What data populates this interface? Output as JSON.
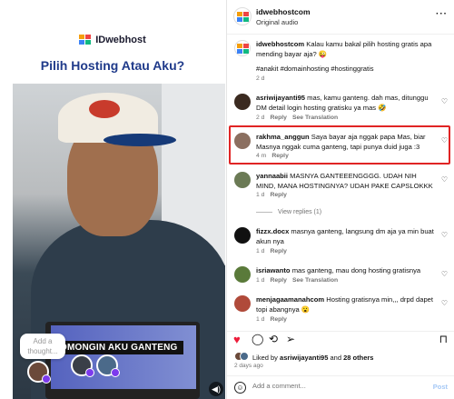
{
  "left": {
    "brand": "IDwebhost",
    "headline": "Pilih Hosting Atau Aku?",
    "caption": "GOMONGIN AKU GANTENG",
    "thought_placeholder": "Add a thought..."
  },
  "header": {
    "username": "idwebhostcom",
    "subtitle": "Original audio",
    "more": "···"
  },
  "caption_post": {
    "username": "idwebhostcom",
    "text": "Kalau kamu bakal pilih hosting gratis apa mending bayar aja? 😜",
    "tags": "#anakit #domainhosting #hostinggratis",
    "time": "2 d"
  },
  "comments": [
    {
      "user": "asriwijayanti95",
      "text": "mas, kamu ganteng. dah mas, ditunggu DM detail login hosting gratisku ya mas 🤣",
      "time": "2 d",
      "reply": "Reply",
      "translate": "See Translation",
      "color": "#3b2a20"
    },
    {
      "user": "rakhma_anggun",
      "text": "Saya bayar aja nggak papa Mas, biar Masnya nggak cuma ganteng, tapi punya duid juga :3",
      "time": "4 m",
      "reply": "Reply",
      "translate": "",
      "color": "#8b6f60"
    },
    {
      "user": "yannaabii",
      "text": "MASNYA GANTEEENGGGG. UDAH NIH MIND, MANA HOSTINGNYA? UDAH PAKE CAPSLOKKK",
      "time": "1 d",
      "reply": "Reply",
      "translate": "",
      "color": "#6b7a55"
    },
    {
      "user": "fizzx.docx",
      "text": "masnya ganteng, langsung dm aja ya min buat akun nya",
      "time": "1 d",
      "reply": "Reply",
      "translate": "",
      "color": "#111111"
    },
    {
      "user": "isriawanto",
      "text": "mas ganteng, mau dong hosting gratisnya",
      "time": "1 d",
      "reply": "Reply",
      "translate": "See Translation",
      "color": "#5a7a3a"
    },
    {
      "user": "menjagaamanahcom",
      "text": "Hosting gratisnya min,,, drpd dapet topi abangnya 😮",
      "time": "1 d",
      "reply": "Reply",
      "translate": "",
      "color": "#b04a3a"
    }
  ],
  "view_replies": "View replies (1)",
  "likes": {
    "prefix": "Liked by",
    "user": "asriwijayanti95",
    "middle": "and",
    "others": "28 others",
    "ago": "2 days ago"
  },
  "composer": {
    "placeholder": "Add a comment...",
    "post": "Post"
  },
  "colors": {
    "highlight": "#e02424",
    "heart": "#ed1c3a",
    "headline": "#1f3a8a",
    "link": "#1d4ed8"
  }
}
